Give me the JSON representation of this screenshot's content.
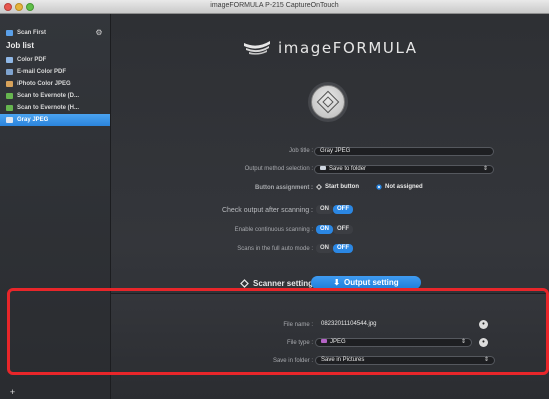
{
  "window": {
    "title": "imageFORMULA P-215 CaptureOnTouch"
  },
  "sidebar": {
    "scan_first": "Scan First",
    "job_list_heading": "Job list",
    "items": [
      {
        "label": "Color PDF",
        "color": "#8fb7e6",
        "selected": false
      },
      {
        "label": "E-mail Color PDF",
        "color": "#7fa3cf",
        "selected": false
      },
      {
        "label": "iPhoto Color JPEG",
        "color": "#d8a35b",
        "selected": false
      },
      {
        "label": "Scan to Evernote (D...",
        "color": "#66b54f",
        "selected": false
      },
      {
        "label": "Scan to Evernote (H...",
        "color": "#66b54f",
        "selected": false
      },
      {
        "label": "Gray JPEG",
        "color": "#dfe5ee",
        "selected": true
      }
    ],
    "add_label": "+"
  },
  "main": {
    "logo_text": "imageFORMULA",
    "job_title_label": "Job title :",
    "job_title_value": "Gray JPEG",
    "output_method_label": "Output method selection :",
    "output_method_value": "Save to folder",
    "button_assignment_label": "Button assignment :",
    "button_opt_start": "Start button",
    "button_opt_none": "Not assigned",
    "check_output_label": "Check output after scanning :",
    "enable_continuous_label": "Enable continuous scanning :",
    "full_auto_label": "Scans in the full auto mode :",
    "toggle_on": "ON",
    "toggle_off": "OFF",
    "toggles": {
      "check_output": "off",
      "enable_continuous": "on",
      "full_auto": "off"
    },
    "tab_scanner": "Scanner setting",
    "tab_output": "Output setting"
  },
  "output_panel": {
    "file_name_label": "File name :",
    "file_name_value": "08232011104544.jpg",
    "file_type_label": "File type :",
    "file_type_value": "JPEG",
    "save_folder_label": "Save in folder :",
    "save_folder_value": "Save in Pictures"
  },
  "colors": {
    "accent": "#2b87e3",
    "highlight": "#e8262a"
  }
}
